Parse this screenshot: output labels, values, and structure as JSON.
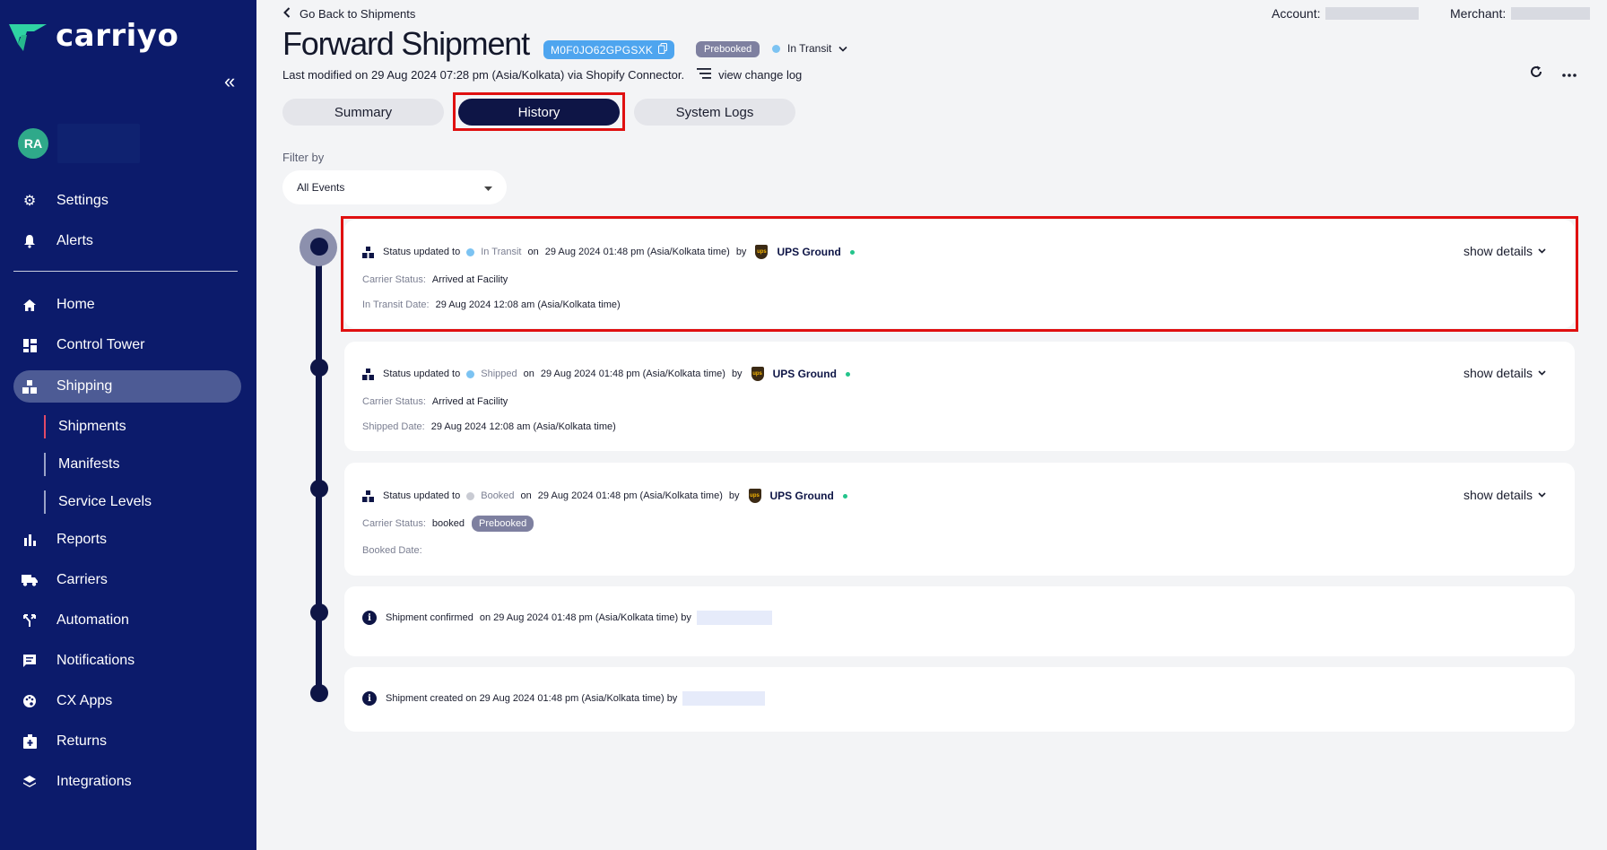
{
  "brand": {
    "name": "carriyo"
  },
  "user": {
    "initials": "RA"
  },
  "sidebar": {
    "items": [
      {
        "label": "Settings",
        "icon": "gear-icon"
      },
      {
        "label": "Alerts",
        "icon": "bell-icon"
      },
      {
        "label": "Home",
        "icon": "home-icon"
      },
      {
        "label": "Control Tower",
        "icon": "dashboard-icon"
      },
      {
        "label": "Shipping",
        "icon": "shipping-icon"
      },
      {
        "label": "Reports",
        "icon": "bar-chart-icon"
      },
      {
        "label": "Carriers",
        "icon": "truck-icon"
      },
      {
        "label": "Automation",
        "icon": "automation-icon"
      },
      {
        "label": "Notifications",
        "icon": "message-icon"
      },
      {
        "label": "CX Apps",
        "icon": "palette-icon"
      },
      {
        "label": "Returns",
        "icon": "returns-icon"
      },
      {
        "label": "Integrations",
        "icon": "layers-icon"
      }
    ],
    "shipping_sub": [
      "Shipments",
      "Manifests",
      "Service Levels"
    ]
  },
  "header": {
    "back_label": "Go Back to Shipments",
    "account_label": "Account:",
    "merchant_label": "Merchant:",
    "title": "Forward Shipment",
    "shipment_id": "M0F0JO62GPGSXK",
    "prebooked_label": "Prebooked",
    "status_label": "In Transit",
    "modified_text": "Last modified on 29 Aug 2024 07:28 pm (Asia/Kolkata) via Shopify Connector.",
    "changelog_label": "view change log"
  },
  "tabs": [
    "Summary",
    "History",
    "System Logs"
  ],
  "filter": {
    "label": "Filter by",
    "value": "All Events"
  },
  "events": [
    {
      "prefix": "Status updated to",
      "status": "In Transit",
      "on": "on",
      "datetime": "29 Aug 2024 01:48 pm (Asia/Kolkata time)",
      "by": "by",
      "carrier": "UPS Ground",
      "carrier_status_label": "Carrier Status:",
      "carrier_status": "Arrived at Facility",
      "date_label": "In Transit Date:",
      "date_value": "29 Aug 2024 12:08 am (Asia/Kolkata time)",
      "details": "show details"
    },
    {
      "prefix": "Status updated to",
      "status": "Shipped",
      "on": "on",
      "datetime": "29 Aug 2024 01:48 pm (Asia/Kolkata time)",
      "by": "by",
      "carrier": "UPS Ground",
      "carrier_status_label": "Carrier Status:",
      "carrier_status": "Arrived at Facility",
      "date_label": "Shipped Date:",
      "date_value": "29 Aug 2024 12:08 am (Asia/Kolkata time)",
      "details": "show details"
    },
    {
      "prefix": "Status updated to",
      "status": "Booked",
      "on": "on",
      "datetime": "29 Aug 2024 01:48 pm (Asia/Kolkata time)",
      "by": "by",
      "carrier": "UPS Ground",
      "carrier_status_label": "Carrier Status:",
      "carrier_status": "booked",
      "badge": "Prebooked",
      "date_label": "Booked Date:",
      "date_value": "",
      "details": "show details"
    }
  ],
  "confirmed": {
    "text": "Shipment confirmed",
    "on": "on 29 Aug 2024 01:48 pm (Asia/Kolkata time) by"
  },
  "created": {
    "text": "Shipment created on 29 Aug 2024 01:48 pm (Asia/Kolkata time) by"
  },
  "colors": {
    "sidebar": "#0c1b6b",
    "accent": "#0e1546",
    "in_transit": "#7cc3f2",
    "booked": "#c9cbd3",
    "highlight": "#e01010"
  }
}
